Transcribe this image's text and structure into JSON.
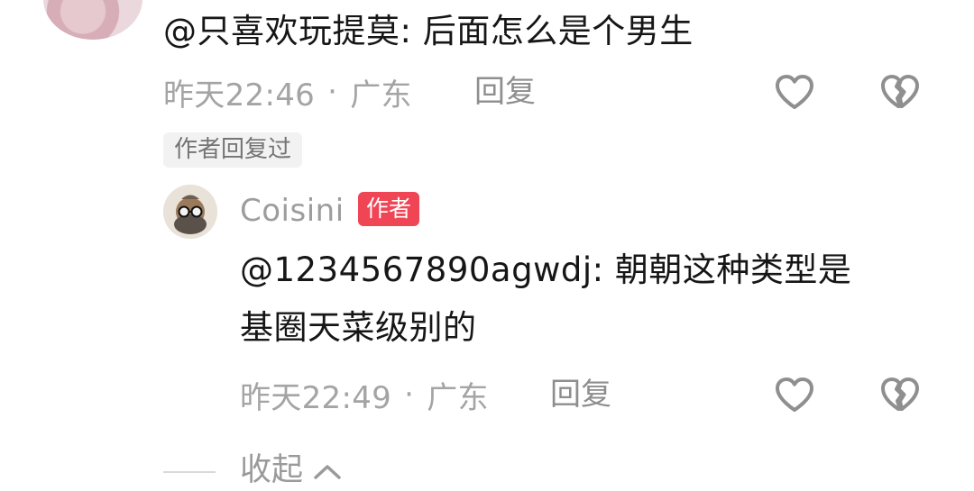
{
  "parent_comment": {
    "text": "@只喜欢玩提莫: 后面怎么是个男生",
    "meta": {
      "time": "昨天22:46",
      "dot": "·",
      "location": "广东",
      "reply": "回复"
    },
    "author_replied": "作者回复过"
  },
  "reply_comment": {
    "username": "Coisini",
    "badge": "作者",
    "text_line1": "@1234567890agwdj: 朝朝这种类型是",
    "text_line2": "基圈天菜级别的",
    "meta": {
      "time": "昨天22:49",
      "dot": "·",
      "location": "广东",
      "reply": "回复"
    }
  },
  "collapse": {
    "label": "收起"
  },
  "icons": {
    "like": "heart-outline-icon",
    "dislike": "broken-heart-icon",
    "collapse": "chevron-up-icon"
  }
}
